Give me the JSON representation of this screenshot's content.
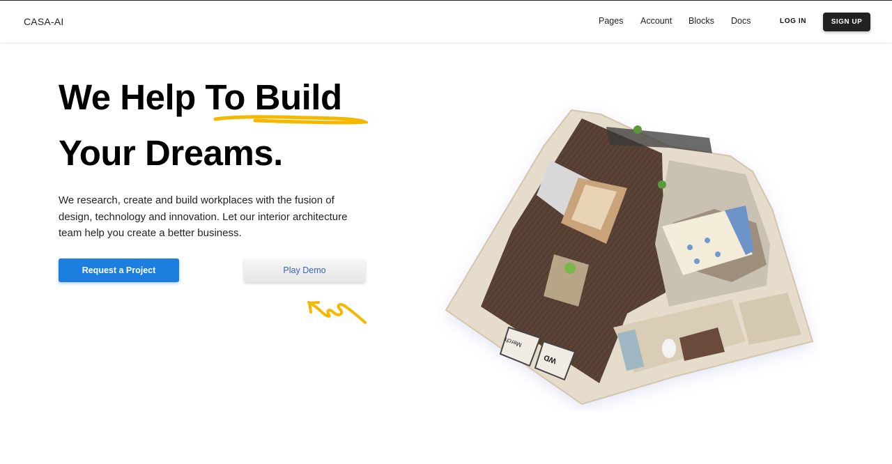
{
  "nav": {
    "brand": "CASA-AI",
    "links": [
      "Pages",
      "Account",
      "Blocks",
      "Docs"
    ],
    "login": "LOG IN",
    "signup": "SIGN UP"
  },
  "hero": {
    "title_line1": "We Help To Build",
    "title_line2": "Your Dreams.",
    "description": "We research, create and build workplaces with the fusion of design, technology and innovation. Let our interior architecture team help you create a better business.",
    "primary_button": "Request a Project",
    "secondary_button": "Play Demo"
  },
  "illustration": {
    "icon": "apartment-floor-plan-3d",
    "wall_signs": [
      "Merch",
      "WD"
    ]
  },
  "colors": {
    "accent_blue": "#1c7fe0",
    "highlight_yellow": "#f5b800",
    "dark": "#222222",
    "demo_text": "#3a62c8"
  }
}
